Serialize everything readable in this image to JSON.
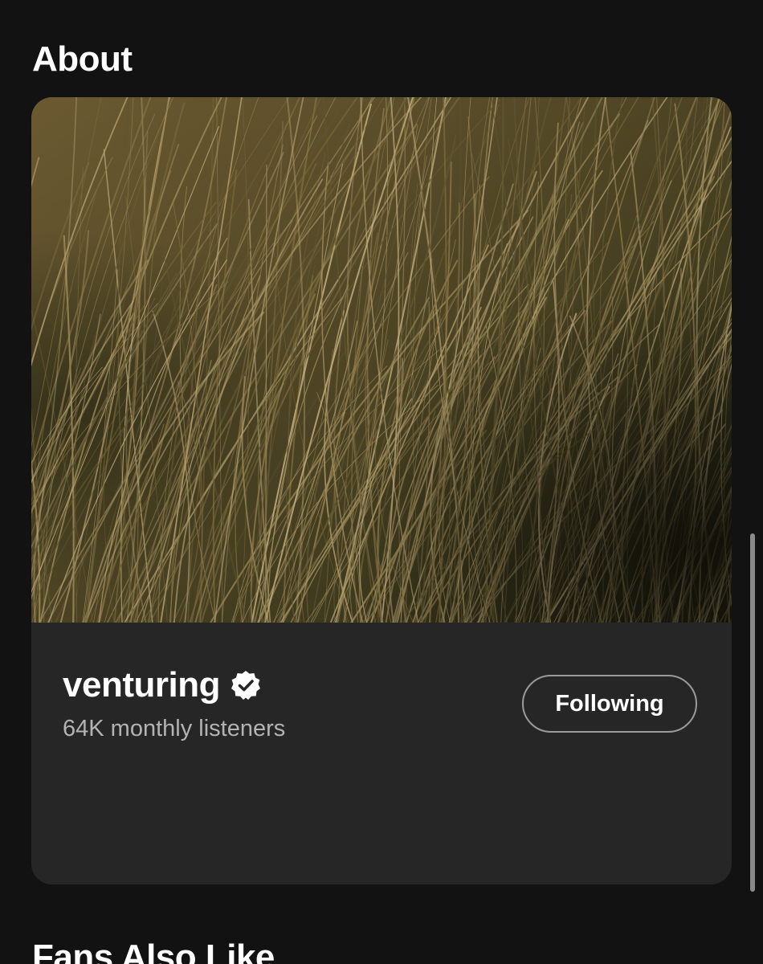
{
  "about": {
    "section_title": "About",
    "artist_image_alt": "venturing",
    "artist_name": "venturing",
    "verified_icon": "verified-badge-icon",
    "monthly_listeners": "64K monthly listeners",
    "follow_button_label": "Following"
  },
  "fans_also_like": {
    "section_title": "Fans Also Like"
  },
  "colors": {
    "background": "#121212",
    "card": "#262626",
    "secondary_text": "#b3b3b3",
    "button_border": "#9a9a9a"
  }
}
